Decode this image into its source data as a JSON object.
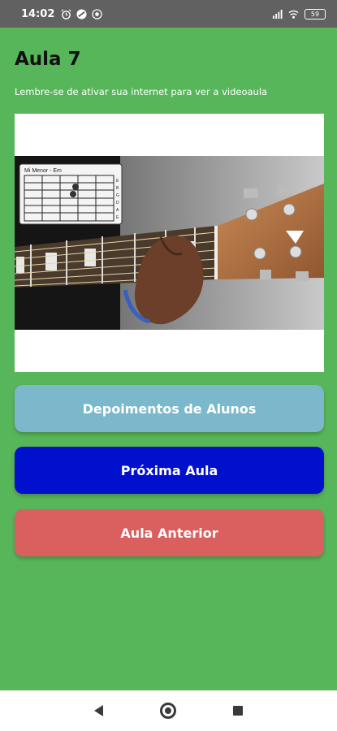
{
  "status_bar": {
    "time": "14:02",
    "battery": "59",
    "icons": [
      "alarm-icon",
      "app-icon",
      "radio-icon",
      "signal-icon",
      "wifi-icon",
      "battery-icon"
    ]
  },
  "lesson": {
    "title": "Aula 7",
    "subtitle": "Lembre-se de ativar sua internet para ver a videoaula"
  },
  "video": {
    "chord_label": "Mi Menor - Em",
    "string_letters": [
      "E",
      "B",
      "G",
      "D",
      "A",
      "E"
    ]
  },
  "buttons": {
    "testimonials": "Depoimentos de Alunos",
    "next": "Próxima Aula",
    "previous": "Aula Anterior"
  },
  "colors": {
    "background": "#58b65a",
    "testimonials": "#7bb8cc",
    "next": "#0010cc",
    "previous": "#d9605e"
  },
  "navigation": {
    "icons": [
      "back-icon",
      "home-icon",
      "recents-icon"
    ]
  }
}
